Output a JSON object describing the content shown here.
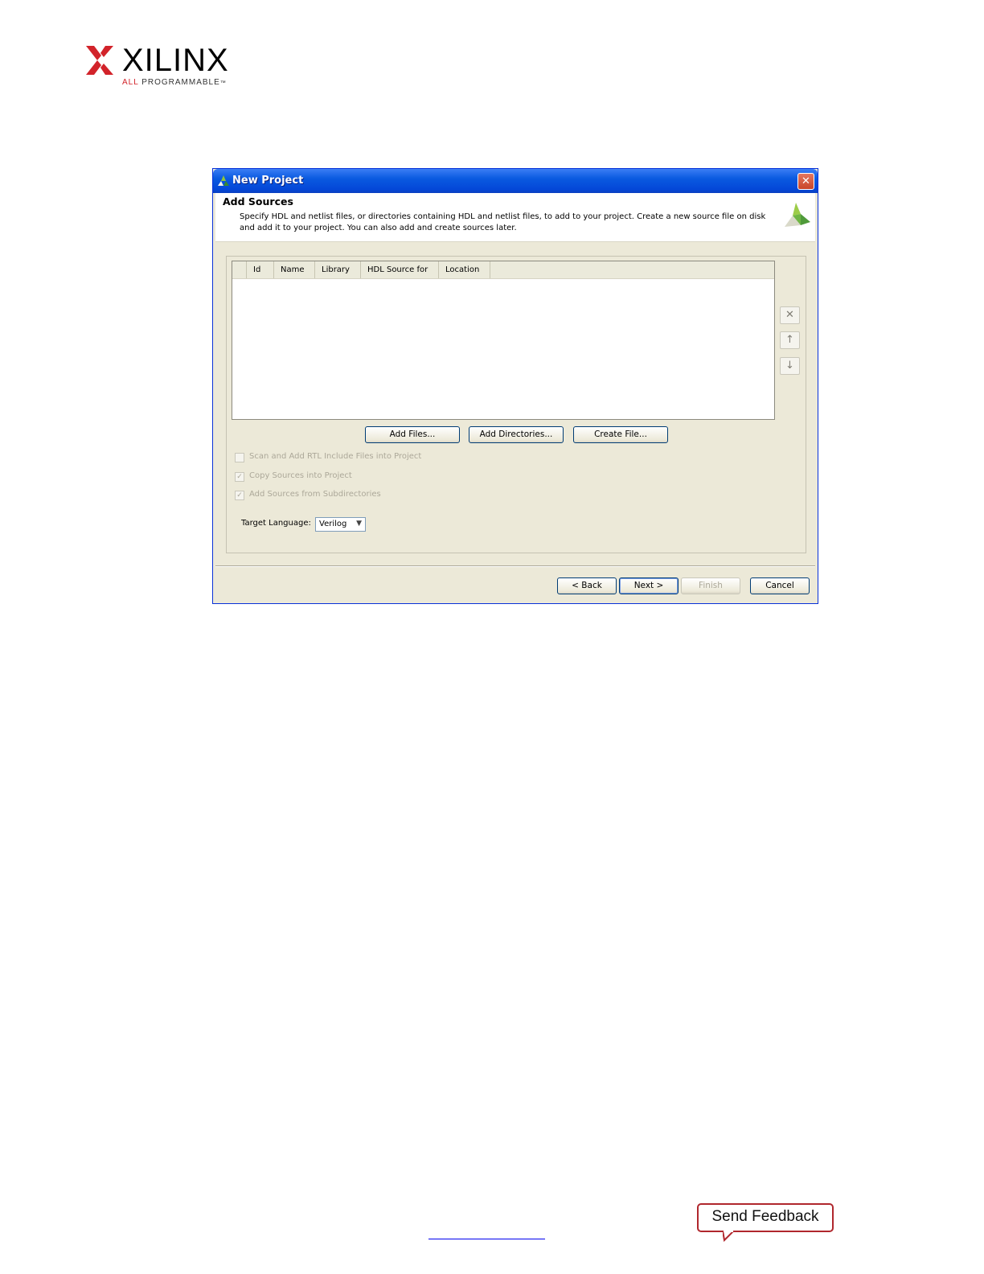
{
  "brand": {
    "name": "XILINX",
    "tagline_highlight": "ALL",
    "tagline_rest": "PROGRAMMABLE",
    "mark": "™",
    "accent_color": "#d2232a"
  },
  "dialog": {
    "title": "New Project",
    "close_label": "✕",
    "header": {
      "title": "Add Sources",
      "description": "Specify HDL and netlist files, or directories containing HDL and netlist files, to add to your project. Create a new source file on disk and add it to your project. You can also add and create sources later."
    },
    "table": {
      "columns": [
        "",
        "Id",
        "Name",
        "Library",
        "HDL Source for",
        "Location"
      ]
    },
    "side_buttons": [
      {
        "icon": "remove-icon",
        "glyph": "✕"
      },
      {
        "icon": "move-up-icon",
        "glyph": "↑"
      },
      {
        "icon": "move-down-icon",
        "glyph": "↓"
      }
    ],
    "action_buttons": {
      "add_files": "Add Files...",
      "add_directories": "Add Directories...",
      "create_file": "Create File..."
    },
    "options": {
      "scan_rtl": {
        "label": "Scan and Add RTL Include Files into Project",
        "checked": false
      },
      "copy_sources": {
        "label": "Copy Sources into Project",
        "checked": true
      },
      "add_subdirs": {
        "label": "Add Sources from Subdirectories",
        "checked": true
      }
    },
    "target_language": {
      "label": "Target Language:",
      "value": "Verilog"
    },
    "footer_buttons": {
      "back": "< Back",
      "next": "Next >",
      "finish": "Finish",
      "cancel": "Cancel"
    }
  },
  "feedback": {
    "label": "Send Feedback",
    "color": "#b0272d"
  }
}
